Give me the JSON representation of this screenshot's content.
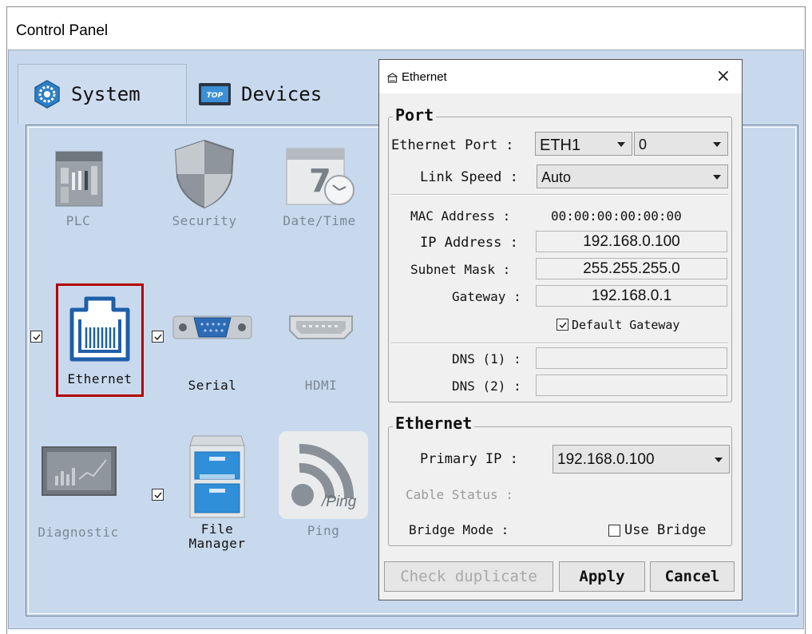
{
  "window": {
    "title": "Control Panel"
  },
  "tabs": [
    {
      "label": "System",
      "icon": "gear-hexagon-icon",
      "selected": true
    },
    {
      "label": "Devices",
      "icon": "top-device-icon",
      "selected": false
    }
  ],
  "tiles": {
    "plc": {
      "label": "PLC",
      "icon": "plc-icon"
    },
    "security": {
      "label": "Security",
      "icon": "shield-icon"
    },
    "datetime": {
      "label": "Date/Time",
      "icon": "calendar-clock-icon"
    },
    "ethernet": {
      "label": "Ethernet",
      "icon": "ethernet-port-icon",
      "checked": true,
      "selected": true
    },
    "serial": {
      "label": "Serial",
      "icon": "serial-port-icon",
      "checked": true
    },
    "hdmi": {
      "label": "HDMI",
      "icon": "hdmi-port-icon"
    },
    "diagnostic": {
      "label": "Diagnostic",
      "icon": "chart-monitor-icon"
    },
    "filemanager": {
      "label_line1": "File",
      "label_line2": "Manager",
      "icon": "file-cabinet-icon",
      "checked": true
    },
    "ping": {
      "label": "Ping",
      "icon": "ping-signal-icon",
      "badge": "/Ping"
    }
  },
  "dialog": {
    "title": "Ethernet",
    "icon": "network-icon",
    "close_glyph": "×",
    "port_group": {
      "title": "Port",
      "ethernet_port_label": "Ethernet Port :",
      "ethernet_port_value": "ETH1",
      "ethernet_port_index": "0",
      "link_speed_label": "Link Speed :",
      "link_speed_value": "Auto",
      "mac_label": "MAC Address :",
      "mac_value": "00:00:00:00:00:00",
      "ip_label": "IP Address :",
      "ip_value": "192.168.0.100",
      "subnet_label": "Subnet Mask :",
      "subnet_value": "255.255.255.0",
      "gateway_label": "Gateway :",
      "gateway_value": "192.168.0.1",
      "default_gateway_label": "Default Gateway",
      "default_gateway_checked": true,
      "dns1_label": "DNS (1) :",
      "dns1_value": "",
      "dns2_label": "DNS (2) :",
      "dns2_value": ""
    },
    "ethernet_group": {
      "title": "Ethernet",
      "primary_ip_label": "Primary IP :",
      "primary_ip_value": "192.168.0.100",
      "cable_status_label": "Cable Status :",
      "bridge_mode_label": "Bridge Mode :",
      "use_bridge_label": "Use Bridge",
      "use_bridge_checked": false
    },
    "buttons": {
      "check_duplicate": "Check duplicate",
      "apply": "Apply",
      "cancel": "Cancel"
    }
  },
  "colors": {
    "panel_bg": "#c8d9ee",
    "dialog_bg": "#f0f0f0",
    "selection_border": "#b30000"
  }
}
